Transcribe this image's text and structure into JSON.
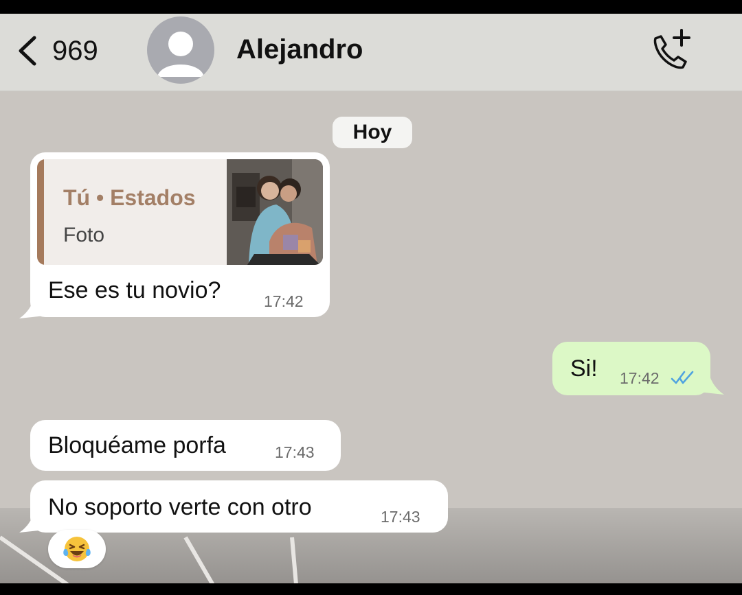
{
  "header": {
    "back_count": "969",
    "contact_name": "Alejandro",
    "icons": [
      "chevron-left-icon",
      "avatar-placeholder-icon",
      "phone-add-icon"
    ]
  },
  "date_chip": "Hoy",
  "messages": [
    {
      "direction": "incoming",
      "quote": {
        "title": "Tú • Estados",
        "subtitle": "Foto"
      },
      "text": "Ese es tu novio?",
      "time": "17:42"
    },
    {
      "direction": "outgoing",
      "text": "Si!",
      "time": "17:42",
      "status": "read"
    },
    {
      "direction": "incoming",
      "text": "Bloquéame porfa",
      "time": "17:43"
    },
    {
      "direction": "incoming",
      "text": "No soporto verte con otro",
      "time": "17:43",
      "reaction": "😂"
    }
  ],
  "colors": {
    "header_bg": "#dcdcd8",
    "incoming_bubble": "#ffffff",
    "outgoing_bubble": "#dcf8c6",
    "quote_accent": "#a57a5c",
    "read_ticks": "#4fa3e0"
  }
}
